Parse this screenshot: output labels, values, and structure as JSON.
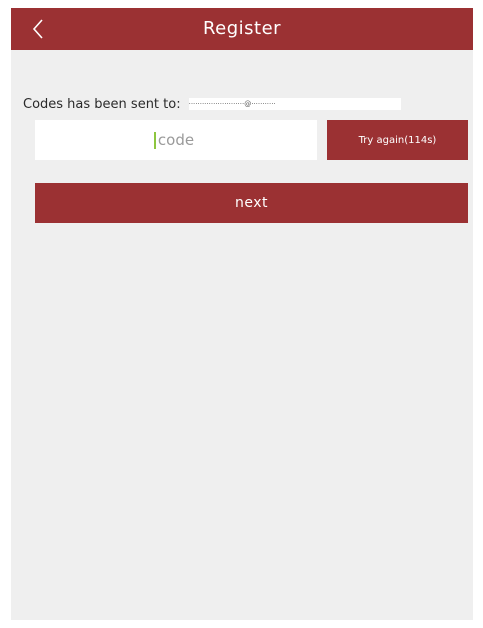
{
  "header": {
    "title": "Register",
    "back_icon": "chevron-left-icon"
  },
  "verification": {
    "sent_label": "Codes has been sent to:",
    "sent_target": "·························@···········",
    "code_value": "",
    "code_placeholder": "code",
    "retry_label": "Try again(114s)"
  },
  "actions": {
    "next_label": "next"
  },
  "colors": {
    "brand": "#9b3133",
    "background": "#efefef",
    "caret": "#8dc63f"
  }
}
